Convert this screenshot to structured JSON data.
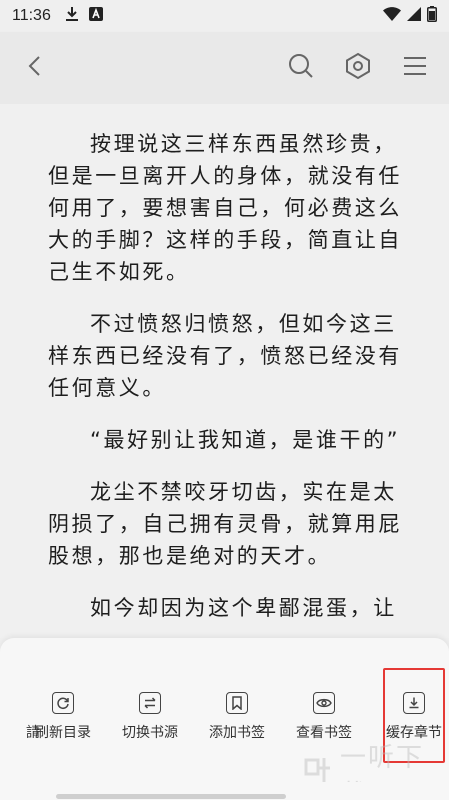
{
  "status_bar": {
    "time": "11:36"
  },
  "toolbar": {
    "back_icon": "chevron-left-icon",
    "search_icon": "search-icon",
    "settings_icon": "hexagon-gear-icon",
    "menu_icon": "hamburger-icon"
  },
  "content": {
    "paragraphs": [
      "按理说这三样东西虽然珍贵，但是一旦离开人的身体，就没有任何用了，要想害自己，何必费这么大的手脚？这样的手段，简直让自己生不如死。",
      "不过愤怒归愤怒，但如今这三样东西已经没有了，愤怒已经没有任何意义。",
      "“最好别让我知道，是谁干的”",
      "龙尘不禁咬牙切齿，实在是太阴损了，自己拥有灵骨，就算用屁股想，那也是绝对的天才。",
      "如今却因为这个卑鄙混蛋，让"
    ]
  },
  "bottom_menu": {
    "partial_label": "請",
    "items": [
      {
        "label": "刷新目录",
        "icon": "refresh-icon"
      },
      {
        "label": "切换书源",
        "icon": "switch-arrows-icon"
      },
      {
        "label": "添加书签",
        "icon": "bookmark-icon"
      },
      {
        "label": "查看书签",
        "icon": "eye-icon"
      },
      {
        "label": "缓存章节",
        "icon": "download-icon"
      }
    ]
  },
  "watermark": {
    "text": "一听下载"
  },
  "colors": {
    "highlight": "#e53935",
    "background": "#f0f0f0",
    "text": "#1e1e1e"
  }
}
